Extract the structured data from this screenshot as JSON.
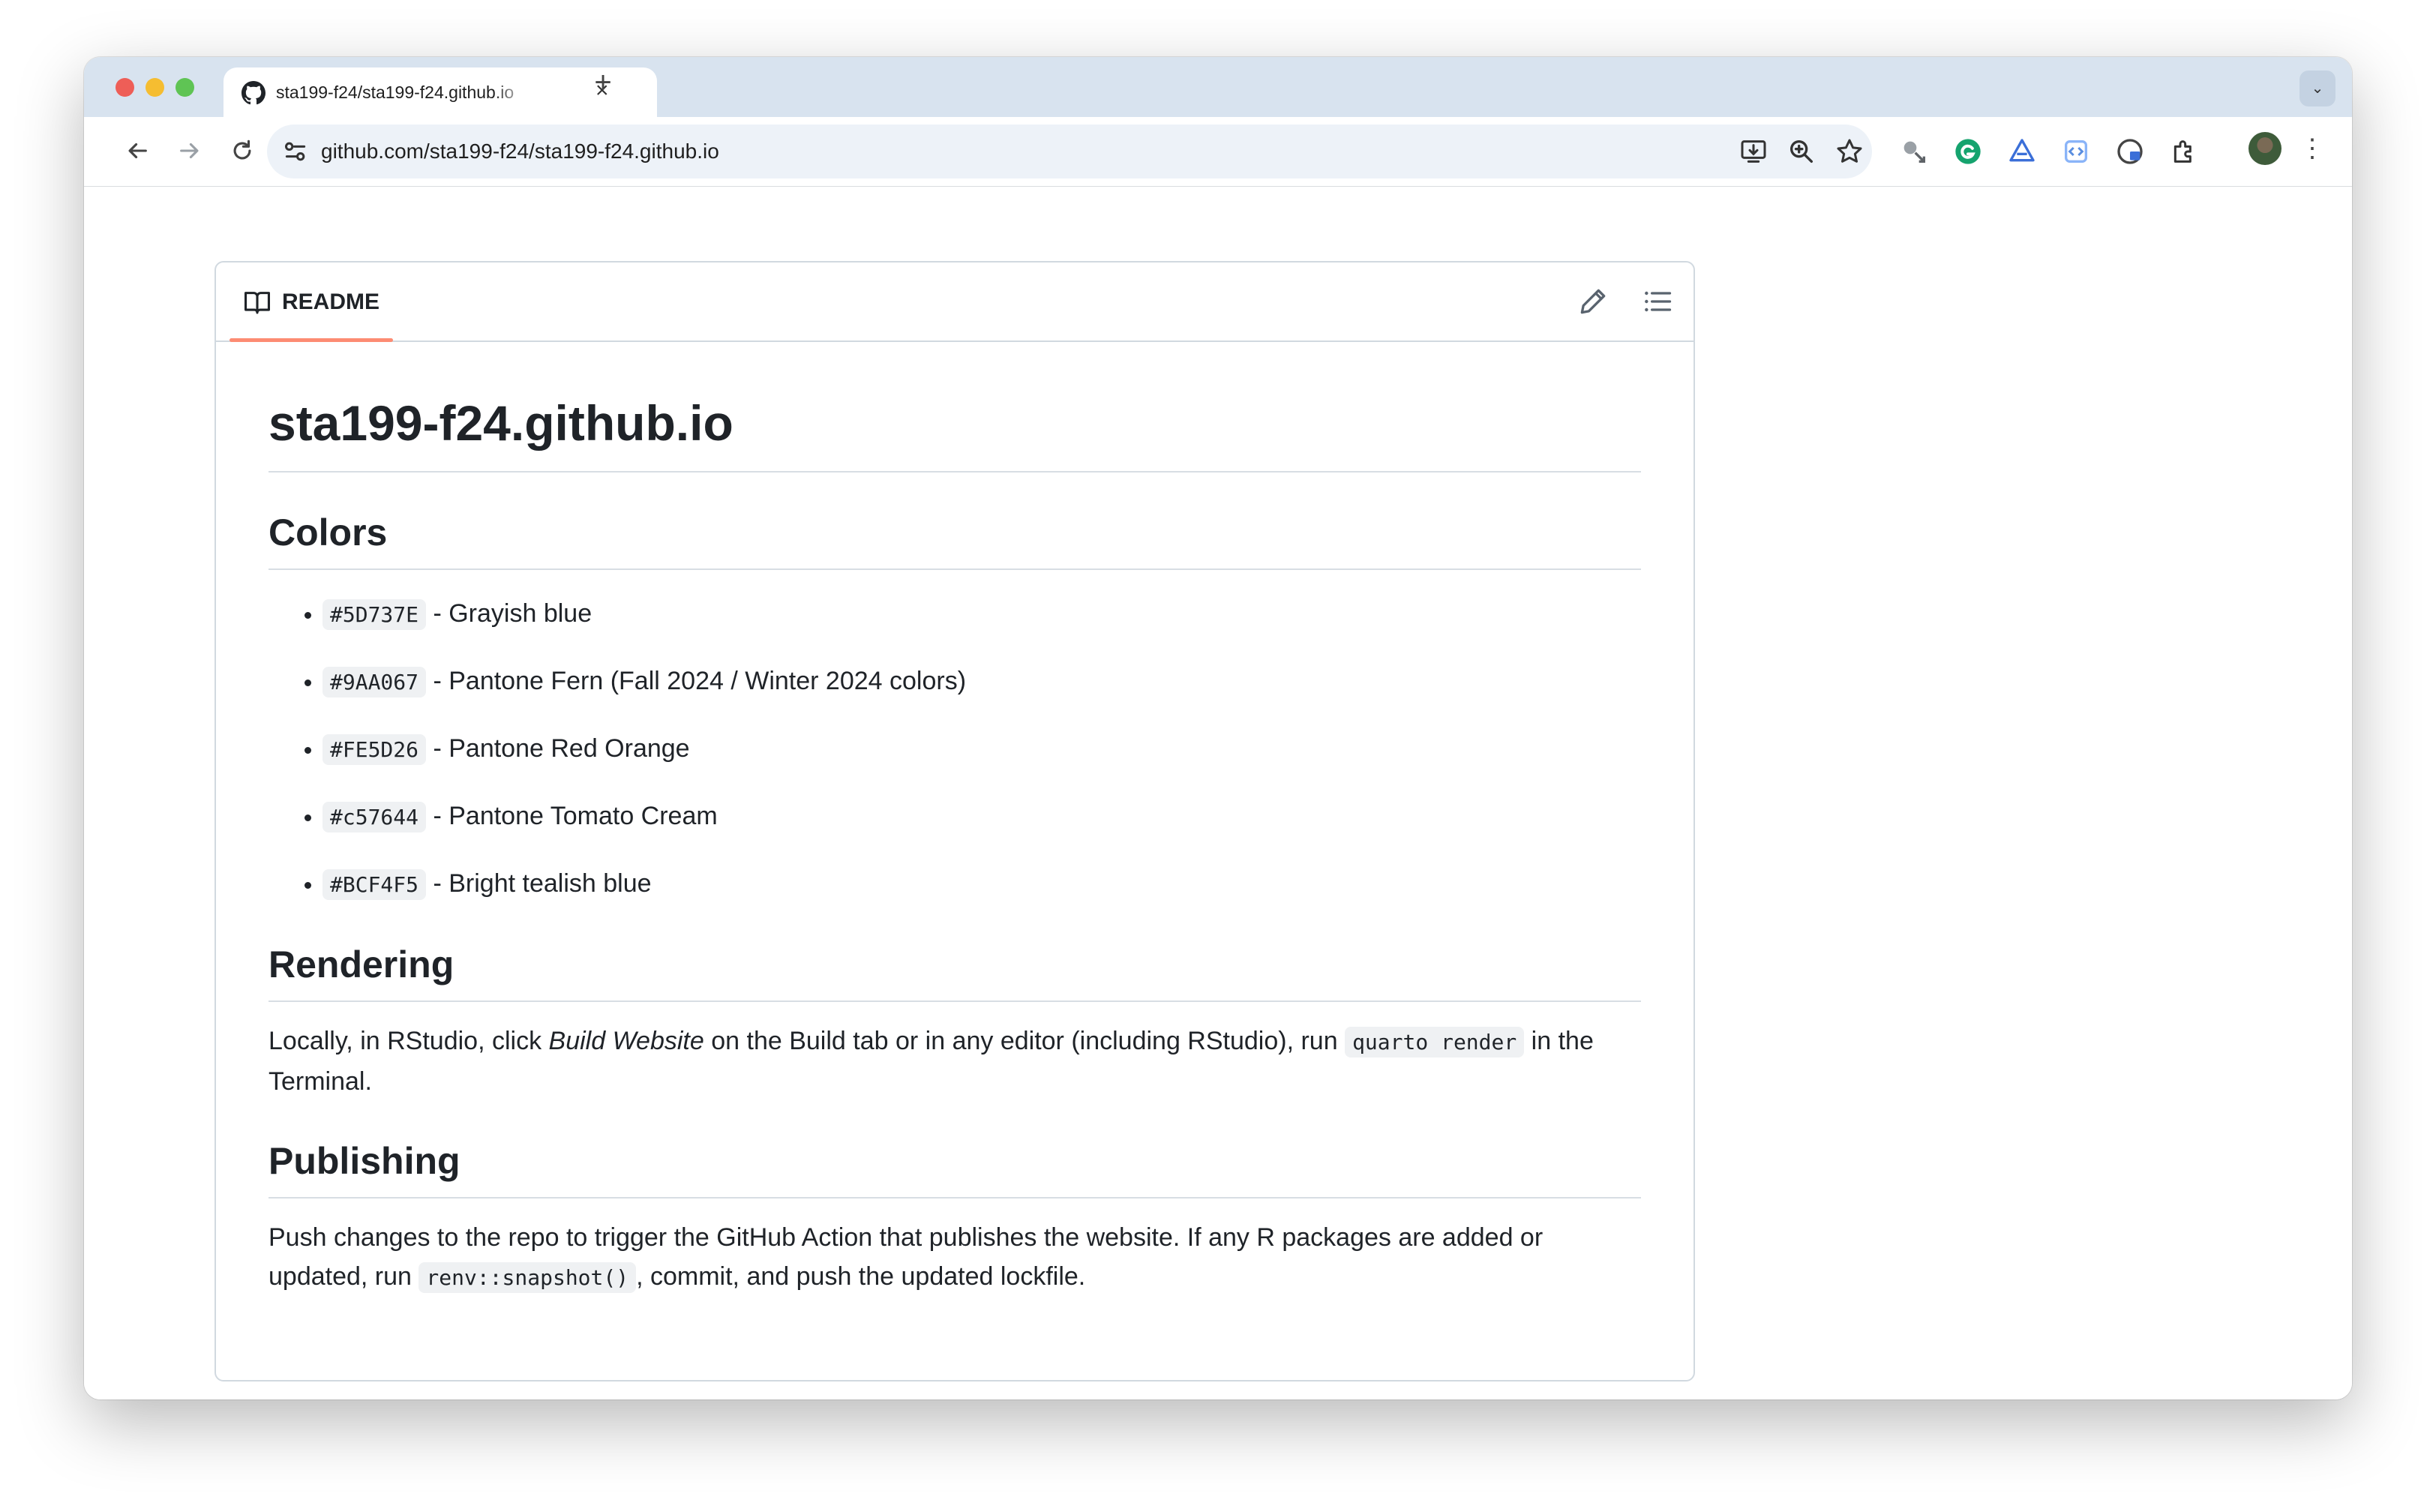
{
  "browser": {
    "tab_title": "sta199-f24/sta199-f24.github.io",
    "url": "github.com/sta199-f24/sta199-f24.github.io",
    "close_glyph": "×",
    "new_tab_glyph": "+",
    "tab_menu_glyph": "⌄",
    "menu_glyph": "⋮"
  },
  "readme": {
    "tab_label": "README",
    "h1": "sta199-f24.github.io",
    "colors_heading": "Colors",
    "colors": [
      {
        "code": "#5D737E",
        "desc": "- Grayish blue"
      },
      {
        "code": "#9AA067",
        "desc": "- Pantone Fern (Fall 2024 / Winter 2024 colors)"
      },
      {
        "code": "#FE5D26",
        "desc": "- Pantone Red Orange"
      },
      {
        "code": "#c57644",
        "desc": "- Pantone Tomato Cream"
      },
      {
        "code": "#BCF4F5",
        "desc": "- Bright tealish blue"
      }
    ],
    "rendering_heading": "Rendering",
    "rendering": {
      "part1": "Locally, in RStudio, click ",
      "emph": "Build Website",
      "part2": " on the Build tab or in any editor (including RStudio), run ",
      "code": "quarto render",
      "part3": " in the Terminal."
    },
    "publishing_heading": "Publishing",
    "publishing": {
      "part1": "Push changes to the repo to trigger the GitHub Action that publishes the website. If any R packages are added or updated, run ",
      "code": "renv::snapshot()",
      "part2": ", commit, and push the updated lockfile."
    }
  }
}
